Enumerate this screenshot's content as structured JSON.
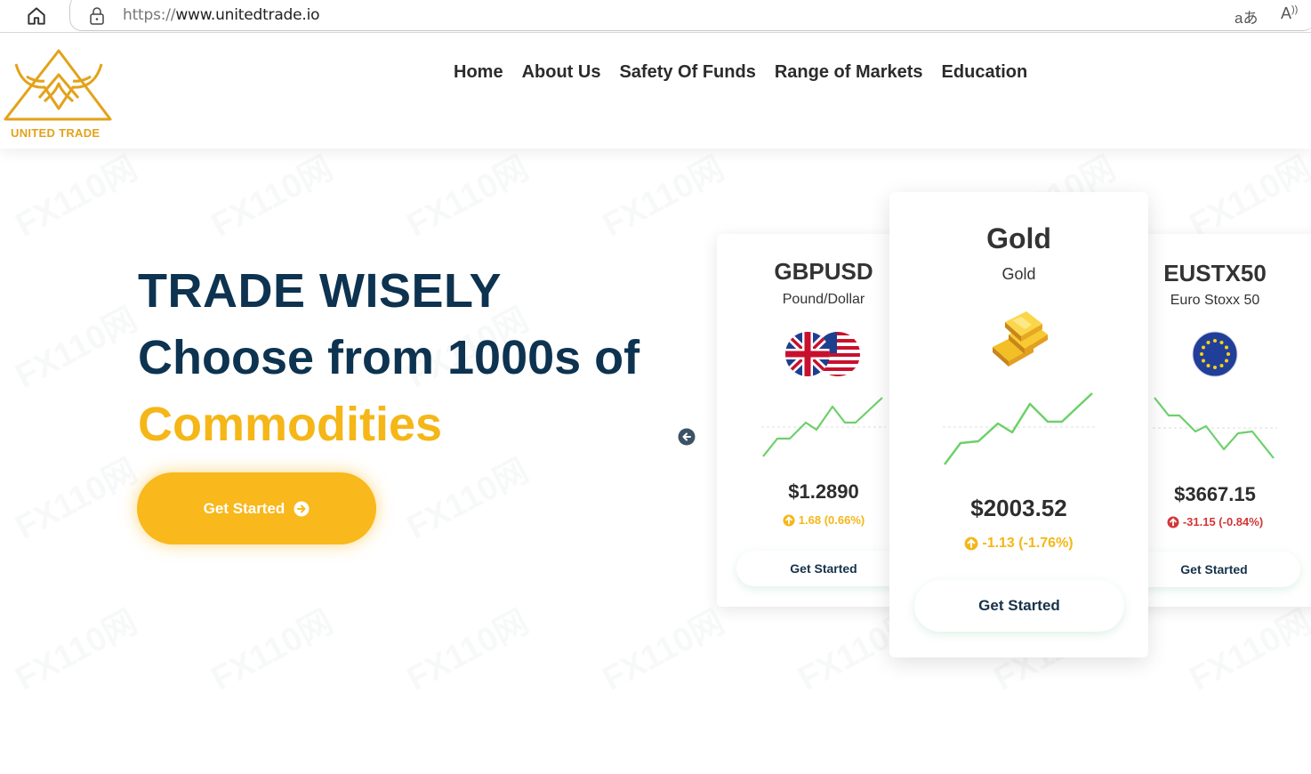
{
  "browser": {
    "url_protocol": "https://",
    "url_host": "www.unitedtrade.io"
  },
  "header": {
    "logo_text": "UNITED TRADE",
    "nav": [
      "Home",
      "About Us",
      "Safety Of Funds",
      "Range of Markets",
      "Education"
    ]
  },
  "hero": {
    "line1": "TRADE WISELY",
    "line2": "Choose from 1000s of",
    "line3": "Commodities",
    "cta_label": "Get Started"
  },
  "cards": [
    {
      "symbol": "GBPUSD",
      "name": "Pound/Dollar",
      "price": "$1.2890",
      "change": "1.68 (0.66%)",
      "direction": "up",
      "button": "Get Started",
      "icon": "uk-us-flags-icon"
    },
    {
      "symbol": "Gold",
      "name": "Gold",
      "price": "$2003.52",
      "change": "-1.13 (-1.76%)",
      "direction": "up",
      "button": "Get Started",
      "icon": "gold-bars-icon"
    },
    {
      "symbol": "EUSTX50",
      "name": "Euro Stoxx 50",
      "price": "$3667.15",
      "change": "-31.15 (-0.84%)",
      "direction": "down",
      "button": "Get Started",
      "icon": "eu-flag-icon"
    }
  ],
  "colors": {
    "navy": "#0d3350",
    "accent": "#f9b81b",
    "up": "#f5b617",
    "down": "#d33636",
    "spark": "#6dd06b"
  }
}
